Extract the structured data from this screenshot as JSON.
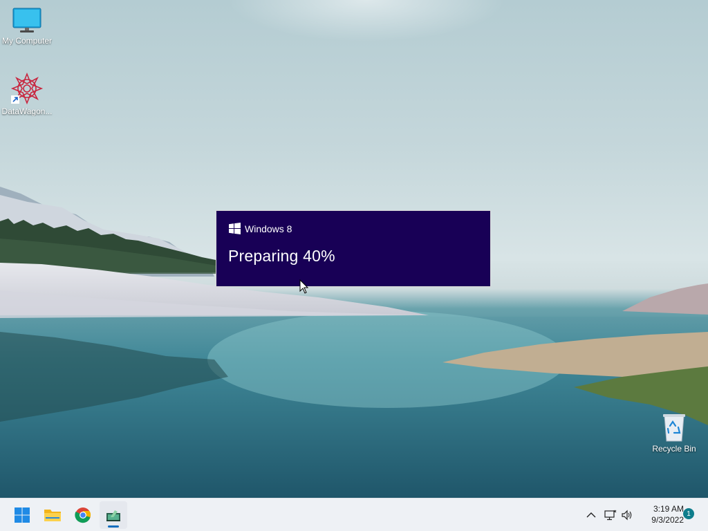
{
  "desktop": {
    "icons": [
      {
        "label": "My Computer",
        "icon": "monitor-icon"
      },
      {
        "label": "DataWagon...",
        "icon": "datawagon-app-icon"
      },
      {
        "label": "Recycle Bin",
        "icon": "recycle-bin-icon"
      }
    ]
  },
  "setup": {
    "brand": "Windows 8",
    "status": "Preparing 40%",
    "progress_percent": 40,
    "background_color": "#180056"
  },
  "taskbar": {
    "apps": [
      {
        "name": "Start",
        "icon": "windows-start-icon"
      },
      {
        "name": "File Explorer",
        "icon": "folder-icon"
      },
      {
        "name": "Google Chrome",
        "icon": "chrome-icon"
      },
      {
        "name": "Setup",
        "icon": "setup-app-icon",
        "active": true
      }
    ],
    "tray": {
      "time": "3:19 AM",
      "date": "9/3/2022",
      "notifications": "1"
    }
  }
}
